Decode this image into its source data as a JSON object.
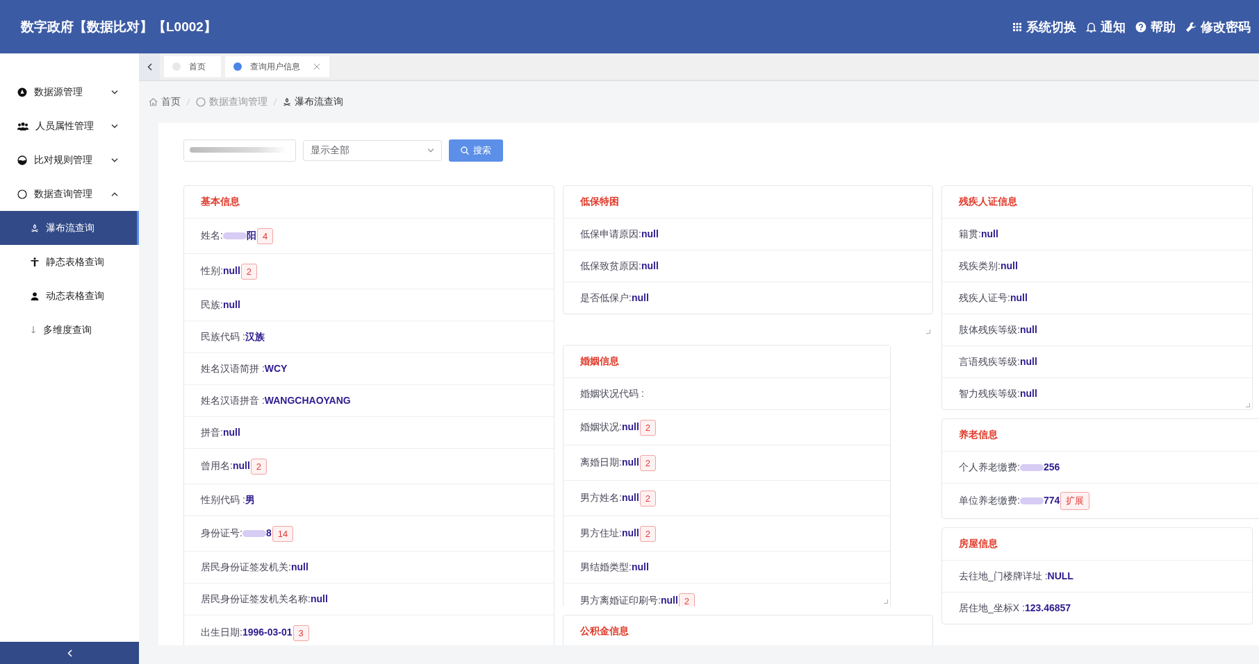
{
  "header": {
    "title": "数字政府【数据比对】【L0002】",
    "actions": [
      {
        "kind": "apps",
        "label": "系统切换"
      },
      {
        "kind": "bell",
        "label": "通知"
      },
      {
        "kind": "help",
        "label": "帮助"
      },
      {
        "kind": "wrench",
        "label": "修改密码"
      }
    ]
  },
  "sidebar": {
    "items": [
      {
        "kind": "source",
        "label": "数据源管理",
        "expanded": false
      },
      {
        "kind": "people",
        "label": "人员属性管理",
        "expanded": false
      },
      {
        "kind": "compare",
        "label": "比对规则管理",
        "expanded": false
      },
      {
        "kind": "circle",
        "label": "数据查询管理",
        "expanded": true,
        "children": [
          {
            "kind": "flow",
            "label": "瀑布流查询",
            "selected": true
          },
          {
            "kind": "figure",
            "label": "静态表格查询",
            "selected": false
          },
          {
            "kind": "person",
            "label": "动态表格查询",
            "selected": false
          },
          {
            "kind": "down",
            "label": "多维度查询",
            "selected": false
          }
        ]
      }
    ]
  },
  "tabs": [
    {
      "label": "首页",
      "selected": false,
      "closable": false
    },
    {
      "label": "查询用户信息",
      "selected": true,
      "closable": true
    }
  ],
  "breadcrumb": [
    {
      "kind": "home",
      "label": "首页"
    },
    {
      "kind": "circle",
      "label": "数据查询管理"
    },
    {
      "kind": "flow",
      "label": "瀑布流查询"
    }
  ],
  "search": {
    "id_field_blurred": true,
    "select": "显示全部",
    "button": "搜索"
  },
  "columns": [
    [
      {
        "title": "基本信息",
        "resize_handle": false,
        "rows": [
          {
            "label": "姓名:",
            "value": "阳",
            "blurred": true,
            "badge": "4"
          },
          {
            "label": "性别:",
            "value": "null",
            "badge": "2"
          },
          {
            "label": "民族:",
            "value": "null"
          },
          {
            "label": "民族代码 :",
            "value": "汉族"
          },
          {
            "label": "姓名汉语简拼 :",
            "value": "WCY"
          },
          {
            "label": "姓名汉语拼音 :",
            "value": "WANGCHAOYANG"
          },
          {
            "label": "拼音:",
            "value": "null"
          },
          {
            "label": "曾用名:",
            "value": "null",
            "badge": "2"
          },
          {
            "label": "性别代码 :",
            "value": "男"
          },
          {
            "label": "身份证号:",
            "value": "8",
            "blurred": true,
            "badge": "14"
          },
          {
            "label": "居民身份证签发机关:",
            "value": "null"
          },
          {
            "label": "居民身份证签发机关名称:",
            "value": "null"
          },
          {
            "label": "出生日期:",
            "value": "1996-03-01",
            "badge": "3"
          }
        ]
      }
    ],
    [
      {
        "title": "低保特困",
        "resize_handle": true,
        "rows": [
          {
            "label": "低保申请原因:",
            "value": "null"
          },
          {
            "label": "低保致贫原因:",
            "value": "null"
          },
          {
            "label": "是否低保户:",
            "value": "null"
          }
        ]
      },
      {
        "title": "婚姻信息",
        "resize_handle": true,
        "rows": [
          {
            "label": "婚姻状况代码 :"
          },
          {
            "label": "婚姻状况:",
            "value": "null",
            "badge": "2"
          },
          {
            "label": "离婚日期:",
            "value": "null",
            "badge": "2"
          },
          {
            "label": "男方姓名:",
            "value": "null",
            "badge": "2"
          },
          {
            "label": "男方住址:",
            "value": "null",
            "badge": "2"
          },
          {
            "label": "男结婚类型:",
            "value": "null"
          },
          {
            "label": "男方离婚证印刷号:",
            "value": "null",
            "badge": "2"
          }
        ]
      },
      {
        "title": "公积金信息",
        "resize_handle": false
      }
    ],
    [
      {
        "title": "残疾人证信息",
        "resize_handle": true,
        "rows": [
          {
            "label": "籍贯:",
            "value": "null"
          },
          {
            "label": "残疾类别:",
            "value": "null"
          },
          {
            "label": "残疾人证号:",
            "value": "null"
          },
          {
            "label": "肢体残疾等级:",
            "value": "null"
          },
          {
            "label": "言语残疾等级:",
            "value": "null"
          },
          {
            "label": "智力残疾等级:",
            "value": "null"
          }
        ]
      },
      {
        "title": "养老信息",
        "resize_handle": false,
        "rows": [
          {
            "label": "个人养老缴费:",
            "value": "256",
            "blurred": true
          },
          {
            "label": "单位养老缴费:",
            "value": "774",
            "blurred": true,
            "badge": "扩展"
          }
        ]
      },
      {
        "title": "房屋信息",
        "resize_handle": false,
        "rows": [
          {
            "label": "去往地_门楼牌详址 :",
            "value": "NULL"
          },
          {
            "label": "居住地_坐标X :",
            "value": "123.46857"
          }
        ]
      }
    ]
  ]
}
